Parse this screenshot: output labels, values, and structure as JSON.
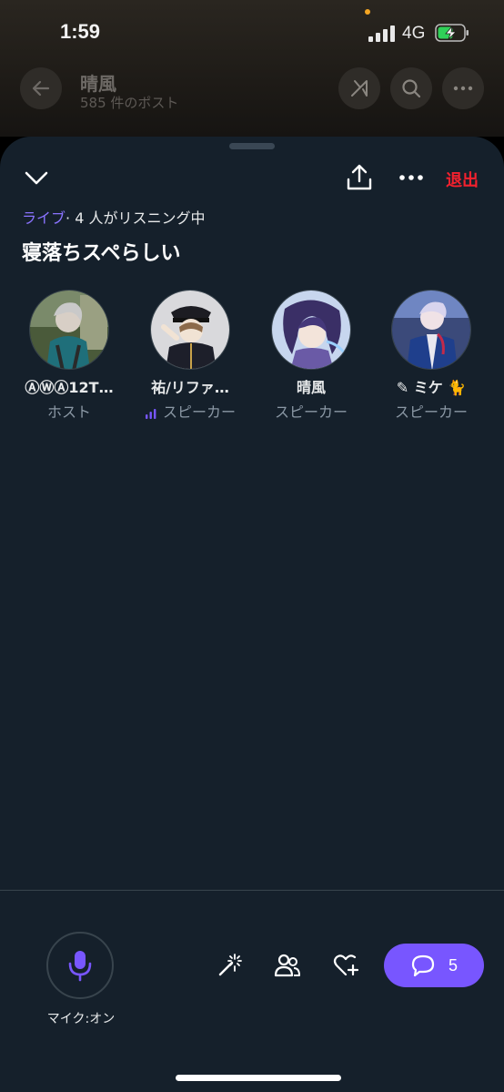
{
  "status_bar": {
    "time": "1:59",
    "network": "4G"
  },
  "background_profile": {
    "name": "晴風",
    "posts": "585 件のポスト"
  },
  "space": {
    "leave_label": "退出",
    "live_label": "ライブ",
    "listening": "· 4 人がリスニング中",
    "title": "寝落ちスペらしい"
  },
  "participants": [
    {
      "name": "ⒶⓌⒶ12T…",
      "role": "ホスト",
      "speaking": false
    },
    {
      "name": "祐/リファ…",
      "role": "スピーカー",
      "speaking": true
    },
    {
      "name": "晴風",
      "role": "スピーカー",
      "speaking": false
    },
    {
      "name": "ミケ",
      "role": "スピーカー",
      "speaking": false
    }
  ],
  "controls": {
    "mic_label": "マイク:オン",
    "comment_count": "5"
  },
  "colors": {
    "accent": "#7856ff",
    "leave": "#f4212e",
    "sheet_bg": "#15202b"
  }
}
